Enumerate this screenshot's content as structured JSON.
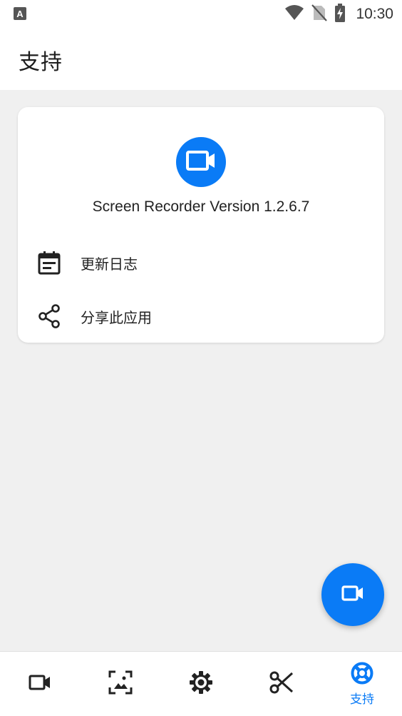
{
  "status_bar": {
    "time": "10:30",
    "left_icon": "a-icon",
    "icons": [
      "wifi-icon",
      "no-sim-icon",
      "battery-charging-icon"
    ]
  },
  "app_bar": {
    "title": "支持"
  },
  "card": {
    "logo_icon": "video-camera-icon",
    "version_text": "Screen Recorder Version 1.2.6.7",
    "items": [
      {
        "icon": "changelog-icon",
        "label": "更新日志"
      },
      {
        "icon": "share-icon",
        "label": "分享此应用"
      }
    ]
  },
  "fab": {
    "icon": "video-camera-icon"
  },
  "bottom_nav": {
    "items": [
      {
        "icon": "video-camera-icon",
        "label": "",
        "active": false
      },
      {
        "icon": "gallery-icon",
        "label": "",
        "active": false
      },
      {
        "icon": "settings-gear-icon",
        "label": "",
        "active": false
      },
      {
        "icon": "scissors-icon",
        "label": "",
        "active": false
      },
      {
        "icon": "support-lifebuoy-icon",
        "label": "支持",
        "active": true
      }
    ]
  },
  "colors": {
    "accent": "#0a7bf6",
    "background": "#f0f0f0",
    "surface": "#ffffff",
    "text": "#222222"
  }
}
